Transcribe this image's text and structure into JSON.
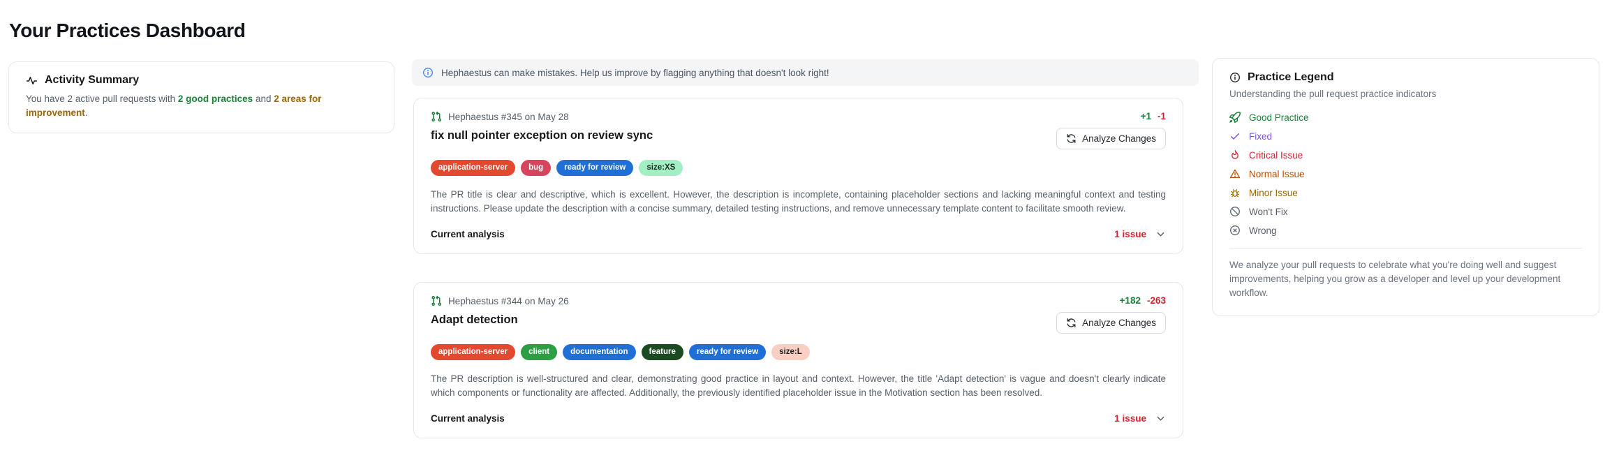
{
  "page": {
    "title": "Your Practices Dashboard"
  },
  "activity_summary": {
    "title": "Activity Summary",
    "text_prefix": "You have 2 active pull requests with ",
    "good_highlight": "2 good practices",
    "connector": " and ",
    "improvement_highlight": "2 areas for improvement",
    "suffix": ".",
    "good_color": "#1a7f37",
    "improvement_color": "#9a6700"
  },
  "banner": {
    "text": "Hephaestus can make mistakes. Help us improve by flagging anything that doesn't look right!",
    "icon": "info-icon",
    "icon_color": "#3b82f6"
  },
  "cards": [
    {
      "meta": "Hephaestus #345 on May 28",
      "additions": "+1",
      "deletions": "-1",
      "title": "fix null pointer exception on review sync",
      "analyze_label": "Analyze Changes",
      "badges": [
        {
          "label": "application-server",
          "bg": "#e2492f",
          "fg": "#ffffff"
        },
        {
          "label": "bug",
          "bg": "#d6455d",
          "fg": "#ffffff"
        },
        {
          "label": "ready for review",
          "bg": "#1f6fd6",
          "fg": "#ffffff"
        },
        {
          "label": "size:XS",
          "bg": "#a3efc4",
          "fg": "#1c2b22"
        }
      ],
      "description": "The PR title is clear and descriptive, which is excellent. However, the description is incomplete, containing placeholder sections and lacking meaningful context and testing instructions. Please update the description with a concise summary, detailed testing instructions, and remove unnecessary template content to facilitate smooth review.",
      "footer_label": "Current analysis",
      "issues": "1 issue"
    },
    {
      "meta": "Hephaestus #344 on May 26",
      "additions": "+182",
      "deletions": "-263",
      "title": "Adapt detection",
      "analyze_label": "Analyze Changes",
      "badges": [
        {
          "label": "application-server",
          "bg": "#e2492f",
          "fg": "#ffffff"
        },
        {
          "label": "client",
          "bg": "#2c9e44",
          "fg": "#ffffff"
        },
        {
          "label": "documentation",
          "bg": "#1f6fd6",
          "fg": "#ffffff"
        },
        {
          "label": "feature",
          "bg": "#1d4b21",
          "fg": "#ffffff"
        },
        {
          "label": "ready for review",
          "bg": "#1f6fd6",
          "fg": "#ffffff"
        },
        {
          "label": "size:L",
          "bg": "#f8cfc2",
          "fg": "#1f2328"
        }
      ],
      "description": "The PR description is well-structured and clear, demonstrating good practice in layout and context. However, the title 'Adapt detection' is vague and doesn't clearly indicate which components or functionality are affected. Additionally, the previously identified placeholder issue in the Motivation section has been resolved.",
      "footer_label": "Current analysis",
      "issues": "1 issue"
    }
  ],
  "legend": {
    "title": "Practice Legend",
    "subtitle": "Understanding the pull request practice indicators",
    "items": [
      {
        "label": "Good Practice",
        "icon": "rocket-icon",
        "color": "#1a7f37"
      },
      {
        "label": "Fixed",
        "icon": "check-icon",
        "color": "#8250df"
      },
      {
        "label": "Critical Issue",
        "icon": "flame-icon",
        "color": "#d1242f"
      },
      {
        "label": "Normal Issue",
        "icon": "warning-triangle-icon",
        "color": "#bc4c00"
      },
      {
        "label": "Minor Issue",
        "icon": "bug-icon",
        "color": "#9a6700"
      },
      {
        "label": "Won't Fix",
        "icon": "circle-slash-icon",
        "color": "#57606a"
      },
      {
        "label": "Wrong",
        "icon": "x-circle-icon",
        "color": "#57606a"
      }
    ],
    "footer": "We analyze your pull requests to celebrate what you're doing well and suggest improvements, helping you grow as a developer and level up your development workflow."
  }
}
